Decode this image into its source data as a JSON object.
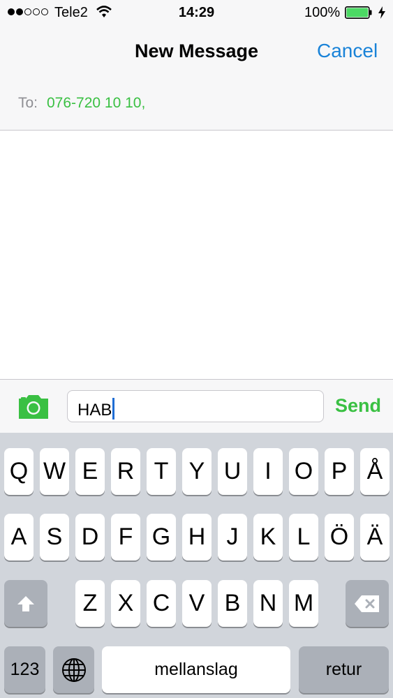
{
  "status_bar": {
    "signal_bars_filled": 2,
    "signal_bars_total": 5,
    "carrier": "Tele2",
    "wifi_icon": "wifi-icon",
    "time": "14:29",
    "battery_percent": "100%",
    "battery_level": 1.0,
    "battery_color": "#4cd964",
    "charging_icon": "bolt-icon"
  },
  "nav": {
    "title": "New Message",
    "cancel_label": "Cancel",
    "accent_color": "#1a83d8"
  },
  "to_field": {
    "label": "To:",
    "recipient": "076-720 10 10,"
  },
  "compose": {
    "camera_icon": "camera-icon",
    "message_text": "HAB",
    "send_label": "Send",
    "accent_color": "#3ac043"
  },
  "keyboard": {
    "row1": [
      "Q",
      "W",
      "E",
      "R",
      "T",
      "Y",
      "U",
      "I",
      "O",
      "P",
      "Å"
    ],
    "row2": [
      "A",
      "S",
      "D",
      "F",
      "G",
      "H",
      "J",
      "K",
      "L",
      "Ö",
      "Ä"
    ],
    "row3": [
      "Z",
      "X",
      "C",
      "V",
      "B",
      "N",
      "M"
    ],
    "numbers_label": "123",
    "space_label": "mellanslag",
    "return_label": "retur",
    "shift_icon": "shift-icon",
    "backspace_icon": "backspace-icon",
    "globe_icon": "globe-icon"
  }
}
